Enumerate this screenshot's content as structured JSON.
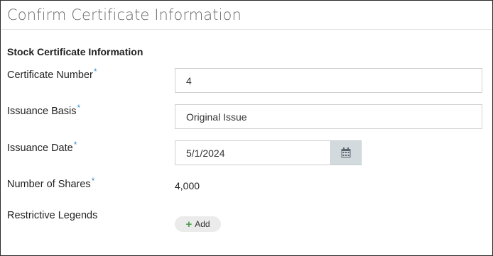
{
  "header": {
    "title": "Confirm Certificate Information"
  },
  "section": {
    "heading": "Stock Certificate Information"
  },
  "required_marker": "*",
  "fields": {
    "certificate_number": {
      "label": "Certificate Number",
      "value": "4"
    },
    "issuance_basis": {
      "label": "Issuance Basis",
      "value": "Original Issue"
    },
    "issuance_date": {
      "label": "Issuance Date",
      "value": "5/1/2024"
    },
    "number_of_shares": {
      "label": "Number of Shares",
      "value": "4,000"
    },
    "restrictive_legends": {
      "label": "Restrictive Legends",
      "add_label": "Add"
    }
  },
  "icons": {
    "calendar": "calendar-icon",
    "add": "plus-icon"
  },
  "colors": {
    "required": "#3b8fd0",
    "add_plus": "#4aa04a",
    "calendar_button": "#d3dade"
  }
}
